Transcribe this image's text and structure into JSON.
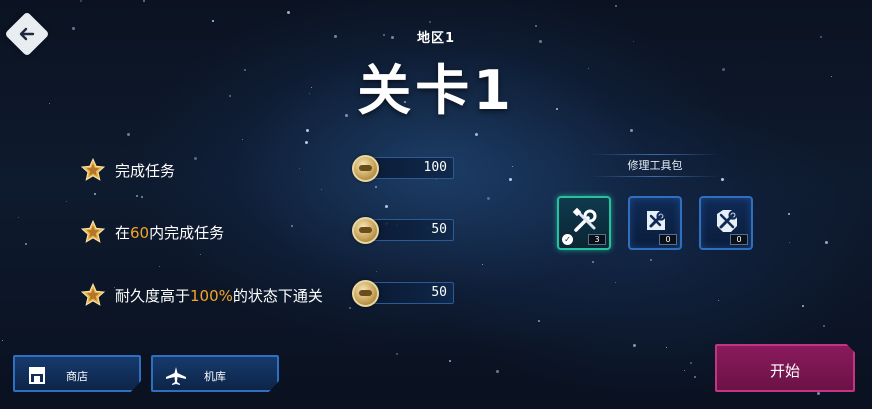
{
  "header": {
    "back_icon": "arrow-left-icon",
    "region": "地区1",
    "level_title": "关卡1"
  },
  "objectives": [
    {
      "icon": "star-icon",
      "text_before": "完成任务",
      "highlight": "",
      "text_after": "",
      "reward_icon": "coin-icon",
      "reward": "100"
    },
    {
      "icon": "star-icon",
      "text_before": "在",
      "highlight": "60",
      "text_after": "内完成任务",
      "reward_icon": "coin-icon",
      "reward": "50"
    },
    {
      "icon": "star-icon",
      "text_before": "耐久度高于",
      "highlight": "100%",
      "text_after": "的状态下通关",
      "reward_icon": "coin-icon",
      "reward": "50"
    }
  ],
  "repair_kits": {
    "title": "修理工具包",
    "items": [
      {
        "icon": "wrench-screwdriver-icon",
        "count": "3",
        "selected": true
      },
      {
        "icon": "armor-repair-icon",
        "count": "0",
        "selected": false
      },
      {
        "icon": "full-repair-icon",
        "count": "0",
        "selected": false
      }
    ]
  },
  "bottom_nav": {
    "shop_label": "商店",
    "shop_icon": "store-icon",
    "hangar_label": "机库",
    "hangar_icon": "airplane-icon"
  },
  "start_label": "开始",
  "colors": {
    "highlight": "#f5a524",
    "accent_blue": "#2e6fbf",
    "selected_teal": "#27c1a0",
    "start_magenta": "#8a1a5c"
  }
}
